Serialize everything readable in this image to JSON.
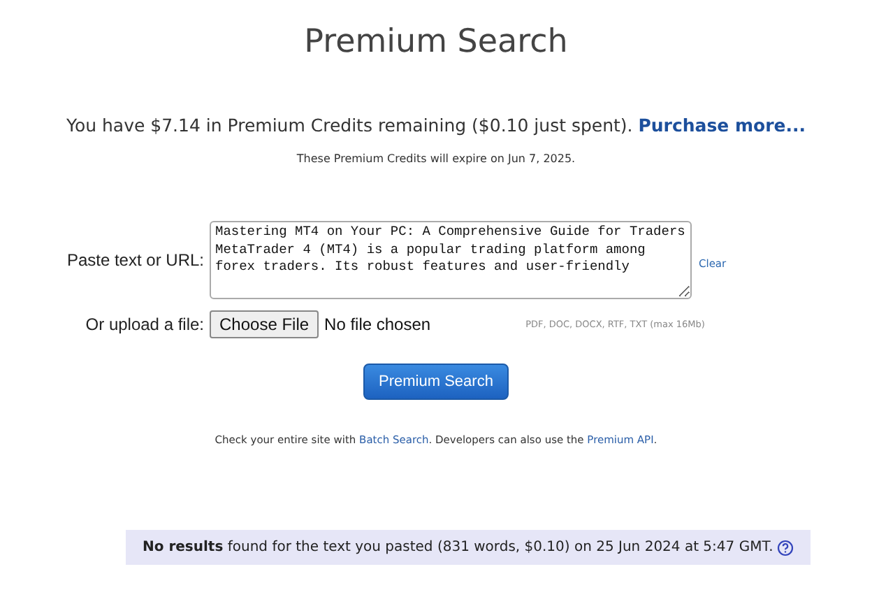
{
  "title": "Premium Search",
  "credits": {
    "text": "You have $7.14 in Premium Credits remaining ($0.10 just spent).",
    "link": "Purchase more..."
  },
  "expiry": "These Premium Credits will expire on Jun 7, 2025.",
  "paste": {
    "label": "Paste text or URL:",
    "value": "Mastering MT4 on Your PC: A Comprehensive Guide for Traders\nMetaTrader 4 (MT4) is a popular trading platform among forex traders. Its robust features and user-friendly",
    "clear": "Clear"
  },
  "upload": {
    "label": "Or upload a file:",
    "button": "Choose File",
    "status": "No file chosen",
    "hint": "PDF, DOC, DOCX, RTF, TXT (max 16Mb)"
  },
  "submit": "Premium Search",
  "footer": [
    {
      "kind": "text",
      "text": "Check your entire site with "
    },
    {
      "kind": "link",
      "text": "Batch Search"
    },
    {
      "kind": "text",
      "text": ". Developers can also use the "
    },
    {
      "kind": "link",
      "text": "Premium API"
    },
    {
      "kind": "text",
      "text": "."
    }
  ],
  "result": "**No results** found for the text you pasted (831 words, $0.10) on 25 Jun 2024 at 5:47 GMT."
}
